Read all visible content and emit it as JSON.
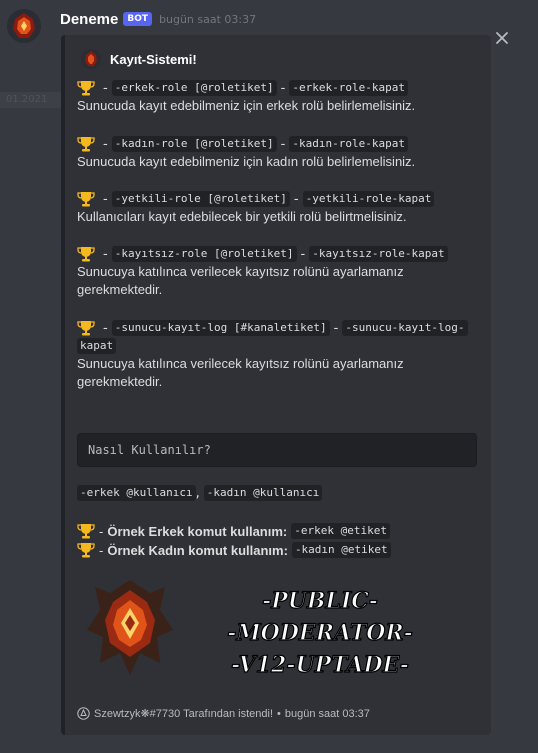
{
  "ghost_text": "01.2021",
  "message": {
    "username": "Deneme",
    "bot_tag": "BOT",
    "timestamp": "bugün saat 03:37"
  },
  "embed": {
    "author": "Kayıt-Sistemi!",
    "commands": [
      {
        "cmd": "-erkek-role [@roletiket]",
        "sep": "-",
        "reset": "-erkek-role-kapat",
        "reset_cont": "",
        "description": [
          "Sunucuda kayıt edebilmeniz için erkek rolü belirlemelisiniz."
        ]
      },
      {
        "cmd": "-kadın-role [@roletiket]",
        "sep": "-",
        "reset": "-kadın-role-kapat",
        "reset_cont": "",
        "description": [
          "Sunucuda kayıt edebilmeniz için kadın rolü belirlemelisiniz."
        ]
      },
      {
        "cmd": "-yetkili-role [@roletiket]",
        "sep": "-",
        "reset": "-yetkili-role-kapat",
        "reset_cont": "",
        "description": [
          "Kullanıcıları kayıt edebilecek bir yetkili rolü belirtmelisiniz."
        ]
      },
      {
        "cmd": "-kayıtsız-role [@roletiket]",
        "sep": "-",
        "reset": "-kayıtsız-role-kapat",
        "reset_cont": "",
        "description": [
          "Sunucuya katılınca verilecek kayıtsız rolünü ayarlamanız",
          "gerekmektedir."
        ]
      },
      {
        "cmd": "-sunucu-kayıt-log [#kanaletiket]",
        "sep": "-",
        "reset": "-sunucu-kayıt-log-",
        "reset_cont": "kapat",
        "description": [
          "Sunucuya katılınca verilecek kayıtsız rolünü ayarlamanız",
          "gerekmektedir."
        ]
      }
    ],
    "codeblock": "Nasıl Kullanılır?",
    "usage": {
      "male": "-erkek @kullanıcı",
      "comma": ",",
      "female": "-kadın @kullanıcı"
    },
    "examples": [
      {
        "label": "Örnek Erkek komut kullanım:",
        "code": "-erkek @etiket"
      },
      {
        "label": "Örnek Kadın komut kullanım:",
        "code": "-kadın @etiket"
      }
    ],
    "image_lines": [
      "-PUBLIC-",
      "-MODERATOR-",
      "-V12-UPTADE-"
    ],
    "footer": {
      "text": "Szewtzyk❋#7730 Tarafından istendi!",
      "separator": "•",
      "time": "bugün saat 03:37"
    }
  },
  "colors": {
    "background": "#36393f",
    "embed_background": "#2f3136",
    "bot_tag": "#5865f2",
    "trophy": "#f5b81e",
    "banner_text": "#ffffff"
  }
}
